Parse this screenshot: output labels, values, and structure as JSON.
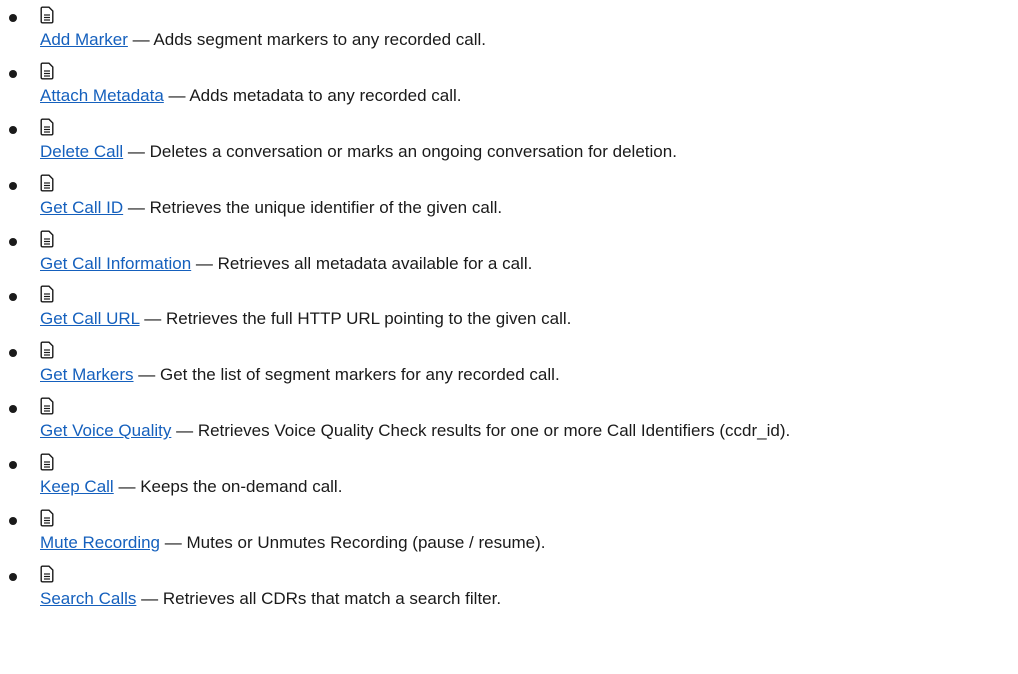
{
  "separator": "—",
  "items": [
    {
      "icon": "document-icon",
      "link": "Add Marker",
      "description": "Adds segment markers to any recorded call."
    },
    {
      "icon": "document-icon",
      "link": "Attach Metadata",
      "description": "Adds metadata to any recorded call."
    },
    {
      "icon": "document-icon",
      "link": "Delete Call",
      "description": "Deletes a conversation or marks an ongoing conversation for deletion."
    },
    {
      "icon": "document-icon",
      "link": "Get Call ID",
      "description": "Retrieves the unique identifier of the given call."
    },
    {
      "icon": "document-icon",
      "link": "Get Call Information",
      "description": "Retrieves all metadata available for a call."
    },
    {
      "icon": "document-icon",
      "link": "Get Call URL",
      "description": "Retrieves the full HTTP URL pointing to the given call."
    },
    {
      "icon": "document-icon",
      "link": "Get Markers",
      "description": "Get the list of segment markers for any recorded call."
    },
    {
      "icon": "document-icon",
      "link": "Get Voice Quality",
      "description": "Retrieves Voice Quality Check results for one or more Call Identifiers (ccdr_id)."
    },
    {
      "icon": "document-icon",
      "link": "Keep Call",
      "description": "Keeps the on-demand call."
    },
    {
      "icon": "document-icon",
      "link": "Mute Recording",
      "description": "Mutes or Unmutes Recording (pause / resume)."
    },
    {
      "icon": "document-icon",
      "link": "Search Calls",
      "description": "Retrieves all CDRs that match a search filter."
    }
  ]
}
